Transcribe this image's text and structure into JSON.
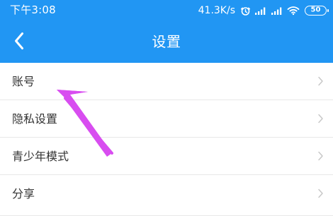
{
  "status_bar": {
    "time": "下午3:08",
    "network_speed": "41.3K/s",
    "battery_level": "50",
    "icons": [
      "alarm-icon",
      "signal-icon",
      "signal-icon",
      "wifi-icon",
      "battery-icon"
    ]
  },
  "header": {
    "title": "设置",
    "back_icon": "chevron-left-icon"
  },
  "settings": {
    "items": [
      {
        "label": "账号",
        "icon": "chevron-right-icon"
      },
      {
        "label": "隐私设置",
        "icon": "chevron-right-icon"
      },
      {
        "label": "青少年模式",
        "icon": "chevron-right-icon"
      },
      {
        "label": "分享",
        "icon": "chevron-right-icon"
      }
    ]
  },
  "annotation": {
    "icon": "arrow-icon",
    "color": "#d84df0"
  },
  "colors": {
    "header": "#2196f3",
    "background": "#f3f3f3",
    "row": "#ffffff",
    "text": "#333333",
    "chevron": "#c8c8c8",
    "divider": "#e8e8e8",
    "annotation_arrow": "#d84df0"
  }
}
